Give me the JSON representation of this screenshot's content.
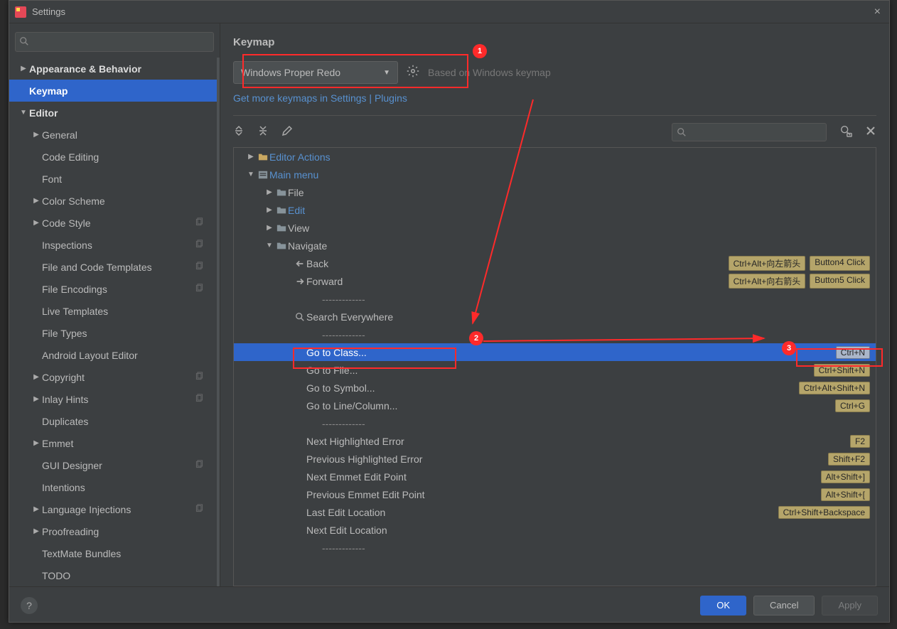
{
  "window": {
    "title": "Settings"
  },
  "sidebar": {
    "search_placeholder": "",
    "items": [
      {
        "label": "Appearance & Behavior",
        "bold": true,
        "arrow": "right",
        "indent": 0
      },
      {
        "label": "Keymap",
        "bold": true,
        "indent": 0,
        "selected": true
      },
      {
        "label": "Editor",
        "bold": true,
        "arrow": "down",
        "indent": 0
      },
      {
        "label": "General",
        "arrow": "right",
        "indent": 1
      },
      {
        "label": "Code Editing",
        "indent": 1
      },
      {
        "label": "Font",
        "indent": 1
      },
      {
        "label": "Color Scheme",
        "arrow": "right",
        "indent": 1
      },
      {
        "label": "Code Style",
        "arrow": "right",
        "indent": 1,
        "copy": true
      },
      {
        "label": "Inspections",
        "indent": 1,
        "copy": true
      },
      {
        "label": "File and Code Templates",
        "indent": 1,
        "copy": true
      },
      {
        "label": "File Encodings",
        "indent": 1,
        "copy": true
      },
      {
        "label": "Live Templates",
        "indent": 1
      },
      {
        "label": "File Types",
        "indent": 1
      },
      {
        "label": "Android Layout Editor",
        "indent": 1
      },
      {
        "label": "Copyright",
        "arrow": "right",
        "indent": 1,
        "copy": true
      },
      {
        "label": "Inlay Hints",
        "arrow": "right",
        "indent": 1,
        "copy": true
      },
      {
        "label": "Duplicates",
        "indent": 1
      },
      {
        "label": "Emmet",
        "arrow": "right",
        "indent": 1
      },
      {
        "label": "GUI Designer",
        "indent": 1,
        "copy": true
      },
      {
        "label": "Intentions",
        "indent": 1
      },
      {
        "label": "Language Injections",
        "arrow": "right",
        "indent": 1,
        "copy": true
      },
      {
        "label": "Proofreading",
        "arrow": "right",
        "indent": 1
      },
      {
        "label": "TextMate Bundles",
        "indent": 1
      },
      {
        "label": "TODO",
        "indent": 1
      }
    ]
  },
  "main": {
    "heading": "Keymap",
    "keymap_select": "Windows Proper Redo",
    "based_on": "Based on Windows keymap",
    "plugins_link": "Get more keymaps in Settings | Plugins",
    "tree": [
      {
        "type": "group",
        "label": "Editor Actions",
        "icon": "folder-open",
        "arrow": "right",
        "indent": 0,
        "blue": true
      },
      {
        "type": "group",
        "label": "Main menu",
        "icon": "menu-folder",
        "arrow": "down",
        "indent": 0,
        "blue": true
      },
      {
        "type": "group",
        "label": "File",
        "icon": "folder",
        "arrow": "right",
        "indent": 1
      },
      {
        "type": "group",
        "label": "Edit",
        "icon": "folder",
        "arrow": "right",
        "indent": 1,
        "blue": true
      },
      {
        "type": "group",
        "label": "View",
        "icon": "folder",
        "arrow": "right",
        "indent": 1
      },
      {
        "type": "group",
        "label": "Navigate",
        "icon": "folder",
        "arrow": "down",
        "indent": 1
      },
      {
        "type": "action",
        "label": "Back",
        "icon": "arrow-left",
        "indent": 2,
        "shortcuts": [
          "Ctrl+Alt+向左箭头",
          "Button4 Click"
        ]
      },
      {
        "type": "action",
        "label": "Forward",
        "icon": "arrow-right",
        "indent": 2,
        "shortcuts": [
          "Ctrl+Alt+向右箭头",
          "Button5 Click"
        ]
      },
      {
        "type": "dash",
        "indent": 2
      },
      {
        "type": "action",
        "label": "Search Everywhere",
        "icon": "search",
        "indent": 2
      },
      {
        "type": "dash",
        "indent": 2
      },
      {
        "type": "action",
        "label": "Go to Class...",
        "indent": 2,
        "selected": true,
        "shortcuts": [
          "Ctrl+N"
        ]
      },
      {
        "type": "action",
        "label": "Go to File...",
        "indent": 2,
        "shortcuts": [
          "Ctrl+Shift+N"
        ]
      },
      {
        "type": "action",
        "label": "Go to Symbol...",
        "indent": 2,
        "shortcuts": [
          "Ctrl+Alt+Shift+N"
        ]
      },
      {
        "type": "action",
        "label": "Go to Line/Column...",
        "indent": 2,
        "shortcuts": [
          "Ctrl+G"
        ]
      },
      {
        "type": "dash",
        "indent": 2
      },
      {
        "type": "action",
        "label": "Next Highlighted Error",
        "indent": 2,
        "shortcuts": [
          "F2"
        ]
      },
      {
        "type": "action",
        "label": "Previous Highlighted Error",
        "indent": 2,
        "shortcuts": [
          "Shift+F2"
        ]
      },
      {
        "type": "action",
        "label": "Next Emmet Edit Point",
        "indent": 2,
        "shortcuts": [
          "Alt+Shift+]"
        ]
      },
      {
        "type": "action",
        "label": "Previous Emmet Edit Point",
        "indent": 2,
        "shortcuts": [
          "Alt+Shift+["
        ]
      },
      {
        "type": "action",
        "label": "Last Edit Location",
        "indent": 2,
        "shortcuts": [
          "Ctrl+Shift+Backspace"
        ]
      },
      {
        "type": "action",
        "label": "Next Edit Location",
        "indent": 2
      },
      {
        "type": "dash",
        "indent": 2
      }
    ]
  },
  "footer": {
    "ok": "OK",
    "cancel": "Cancel",
    "apply": "Apply"
  },
  "annotations": {
    "b1": "1",
    "b2": "2",
    "b3": "3"
  }
}
